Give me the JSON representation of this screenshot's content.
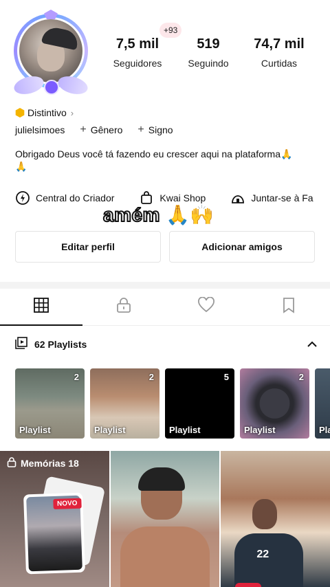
{
  "profile": {
    "plus_badge": "+93",
    "stats": [
      {
        "value": "7,5 mil",
        "label": "Seguidores"
      },
      {
        "value": "519",
        "label": "Seguindo"
      },
      {
        "value": "74,7 mil",
        "label": "Curtidas"
      }
    ],
    "badge_label": "Distintivo",
    "username": "julielsimoes",
    "tags": [
      "Gênero",
      "Signo"
    ],
    "bio": "Obrigado Deus você tá fazendo eu crescer aqui na plataforma🙏\n🙏"
  },
  "quick_links": [
    {
      "label": "Central do Criador",
      "icon": "creator-center-icon"
    },
    {
      "label": "Kwai Shop",
      "icon": "shopping-bag-icon"
    },
    {
      "label": "Juntar-se à Fa",
      "icon": "fan-group-icon"
    }
  ],
  "sticker": {
    "text": "amém",
    "emoji": "🙏🙌"
  },
  "actions": {
    "edit_profile": "Editar perfil",
    "add_friends": "Adicionar amigos"
  },
  "tabs": [
    {
      "icon": "grid-icon",
      "active": true
    },
    {
      "icon": "lock-icon",
      "active": false
    },
    {
      "icon": "heart-icon",
      "active": false
    },
    {
      "icon": "bookmark-icon",
      "active": false
    }
  ],
  "playlists": {
    "header": "62 Playlists",
    "items": [
      {
        "label": "Playlist",
        "count": "2"
      },
      {
        "label": "Playlist",
        "count": "2"
      },
      {
        "label": "Playlist",
        "count": "5"
      },
      {
        "label": "Playlist",
        "count": "2"
      },
      {
        "label": "Pla",
        "count": ""
      }
    ]
  },
  "memories": {
    "title": "Memórias 18",
    "badge": "NOVO"
  },
  "grid_extra": {
    "jersey_number": "22"
  },
  "colors": {
    "accent": "#e0223b",
    "text": "#111111",
    "divider": "#f3f3f3"
  }
}
